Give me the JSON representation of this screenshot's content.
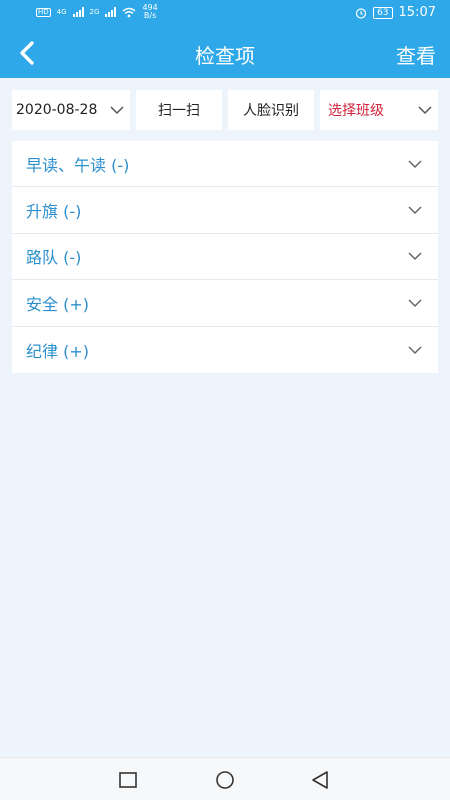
{
  "status": {
    "left_badge": "HD",
    "net1": "4G",
    "net2": "2G",
    "speed_value": "494",
    "speed_unit": "B/s",
    "battery": "63",
    "time": "15:07"
  },
  "header": {
    "title": "检查项",
    "view_label": "查看"
  },
  "filters": {
    "date": "2020-08-28",
    "scan": "扫一扫",
    "face": "人脸识别",
    "class_select": "选择班级"
  },
  "items": [
    {
      "label": "早读、午读 (-)"
    },
    {
      "label": "升旗 (-)"
    },
    {
      "label": "路队 (-)"
    },
    {
      "label": "安全 (+)"
    },
    {
      "label": "纪律 (+)"
    }
  ],
  "colors": {
    "primary": "#2ea8e8",
    "item_text": "#2b8fce",
    "class_select_text": "#d0243c",
    "background": "#eef4fb"
  }
}
